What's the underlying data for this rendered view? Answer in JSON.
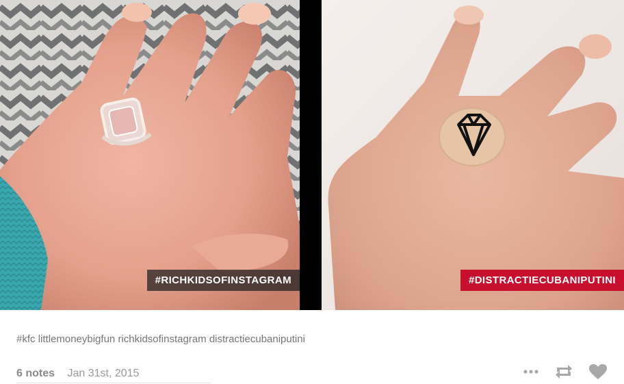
{
  "post": {
    "photoset": {
      "left_caption": "#RICHKIDSOFINSTAGRAM",
      "right_caption": "#DISTRACTIECUBANIPUTINI"
    },
    "tags": [
      "#kfc",
      "littlemoneybigfun",
      "richkidsofinstagram",
      "distractiecubaniputini"
    ],
    "notes": "6 notes",
    "date": "Jan 31st, 2015",
    "controls": [
      "more-icon",
      "reblog-icon",
      "like-icon"
    ],
    "colors": {
      "accent_red": "#c8102e",
      "label_dark": "#1e1e1e",
      "muted_text": "#9a9a9a",
      "icon_gray": "#a8a8a8"
    }
  }
}
